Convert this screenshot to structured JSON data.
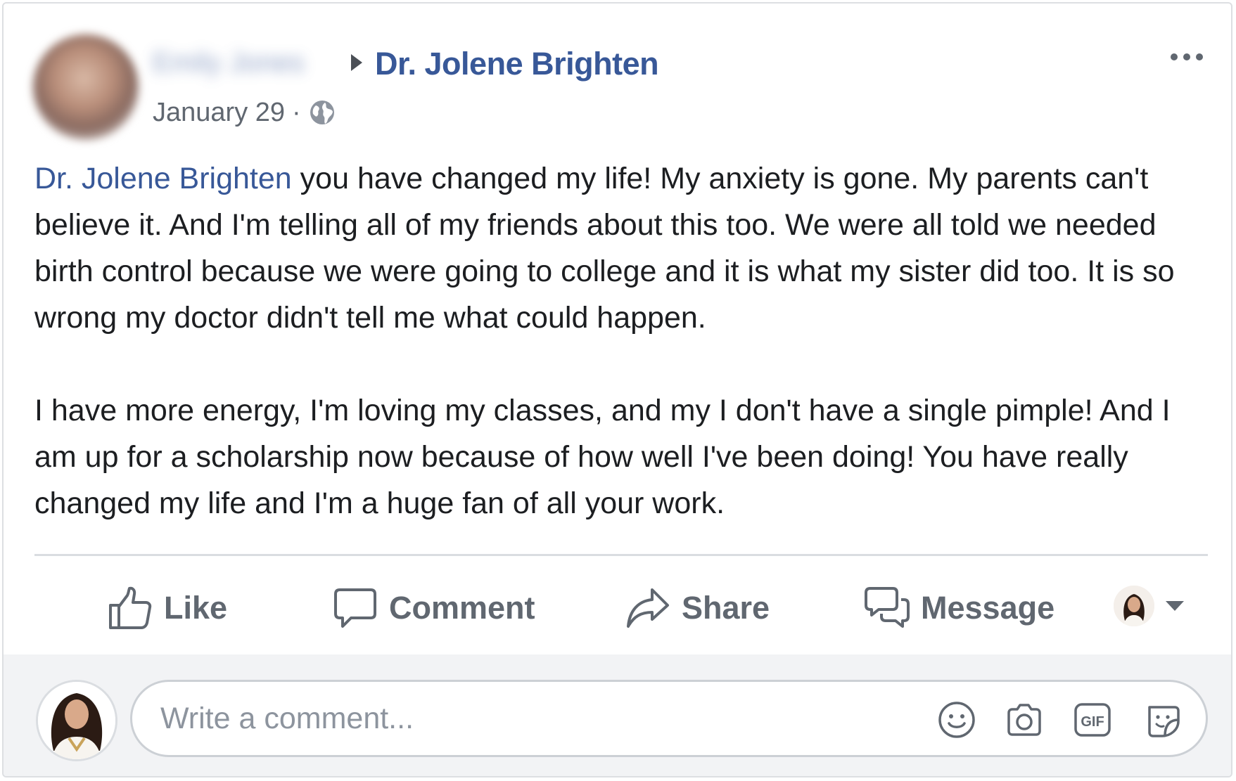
{
  "post": {
    "author_name": "Emily Jones",
    "target_page": "Dr. Jolene Brighten",
    "date": "January 29",
    "date_separator": "·",
    "privacy_icon": "globe-icon",
    "more_icon": "more-options-icon",
    "mention": "Dr. Jolene Brighten",
    "paragraph1_rest": " you have changed my life! My anxiety is gone. My parents can't believe it. And I'm telling all of my friends about this too. We were all told we needed birth control because we were going to college and it is what my sister did too. It is so wrong my doctor didn't tell me what could happen.",
    "paragraph2": "I have more energy, I'm loving my classes, and my I don't have a single pimple! And I am up for a scholarship now because of how well I've been doing! You have really changed my life and I'm a huge fan of all your work."
  },
  "actions": {
    "like": "Like",
    "comment": "Comment",
    "share": "Share",
    "message": "Message"
  },
  "composer": {
    "placeholder": "Write a comment...",
    "icons": [
      "emoji-icon",
      "camera-icon",
      "gif-icon",
      "sticker-icon"
    ]
  },
  "colors": {
    "link": "#385898",
    "text": "#1c1e21",
    "muted": "#606770",
    "divider": "#dadde1",
    "composer_bg": "#f2f3f5"
  }
}
